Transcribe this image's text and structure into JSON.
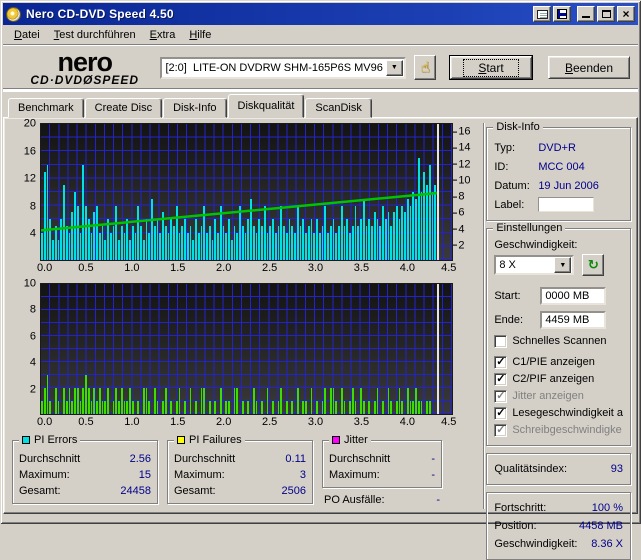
{
  "window": {
    "title": "Nero CD-DVD Speed 4.50"
  },
  "menu": {
    "items": [
      "Datei",
      "Test durchführen",
      "Extra",
      "Hilfe"
    ]
  },
  "toolbar": {
    "logo_line1": "nero",
    "logo_line2": "CD·DVDØSPEED",
    "drive": "[2:0]  LITE-ON DVDRW SHM-165P6S MV96",
    "start_label": "Start",
    "quit_label": "Beenden"
  },
  "tabs": [
    "Benchmark",
    "Create Disc",
    "Disk-Info",
    "Diskqualität",
    "ScanDisk"
  ],
  "active_tab": "Diskqualität",
  "disk_info": {
    "title": "Disk-Info",
    "rows": [
      {
        "label": "Typ:",
        "value": "DVD+R"
      },
      {
        "label": "ID:",
        "value": "MCC 004"
      },
      {
        "label": "Datum:",
        "value": "19 Jun 2006"
      }
    ],
    "label_label": "Label:"
  },
  "settings": {
    "title": "Einstellungen",
    "speed_label": "Geschwindigkeit:",
    "speed_value": "8 X",
    "start_label": "Start:",
    "start_value": "0000 MB",
    "end_label": "Ende:",
    "end_value": "4459 MB",
    "checkboxes": [
      {
        "label": "Schnelles Scannen",
        "checked": false,
        "enabled": true
      },
      {
        "label": "C1/PIE anzeigen",
        "checked": true,
        "enabled": true
      },
      {
        "label": "C2/PIF anzeigen",
        "checked": true,
        "enabled": true
      },
      {
        "label": "Jitter anzeigen",
        "checked": true,
        "enabled": false
      },
      {
        "label": "Lesegeschwindigkeit a",
        "checked": true,
        "enabled": true
      },
      {
        "label": "Schreibgeschwindigke",
        "checked": true,
        "enabled": false
      }
    ]
  },
  "quality": {
    "label": "Qualitätsindex:",
    "value": "93"
  },
  "progress": {
    "rows": [
      {
        "label": "Fortschritt:",
        "value": "100 %"
      },
      {
        "label": "Position:",
        "value": "4458 MB"
      },
      {
        "label": "Geschwindigkeit:",
        "value": "8.36 X"
      }
    ]
  },
  "stats": {
    "boxes": [
      {
        "title": "PI Errors",
        "color": "#00e0e0",
        "rows": [
          [
            "Durchschnitt",
            "2.56"
          ],
          [
            "Maximum:",
            "15"
          ],
          [
            "Gesamt:",
            "24458"
          ]
        ]
      },
      {
        "title": "PI Failures",
        "color": "#ffff00",
        "rows": [
          [
            "Durchschnitt",
            "0.11"
          ],
          [
            "Maximum:",
            "3"
          ],
          [
            "Gesamt:",
            "2506"
          ]
        ]
      },
      {
        "title": "Jitter",
        "color": "#ff00ff",
        "rows": [
          [
            "Durchschnitt",
            "-"
          ],
          [
            "Maximum:",
            "-"
          ]
        ]
      }
    ],
    "po_label": "PO Ausfälle:",
    "po_value": "-"
  },
  "colors": {
    "pi_errors_bar": "#00e2e2",
    "pi_failures_bar": "#3ddd00",
    "speed_line": "#00c400",
    "grid_line": "#2323cd",
    "value_text": "#00008a"
  },
  "chart_data": [
    {
      "type": "bar",
      "name": "PI Errors scan",
      "color": "#00e2e2",
      "xlim": [
        0,
        4.5
      ],
      "x_ticks": [
        "0.0",
        "0.5",
        "1.0",
        "1.5",
        "2.0",
        "2.5",
        "3.0",
        "3.5",
        "4.0",
        "4.5"
      ],
      "ylim": [
        0,
        20
      ],
      "y_ticks_left": [
        "20",
        "16",
        "12",
        "8",
        "4"
      ],
      "y_right_lim": [
        0,
        17
      ],
      "y_ticks_right": [
        "16",
        "14",
        "12",
        "10",
        "8",
        "6",
        "4",
        "2"
      ],
      "bar_end_x": 4.33,
      "cursor_x": 4.33,
      "values": [
        4,
        13,
        14,
        6,
        3,
        5,
        3,
        6,
        11,
        5,
        4,
        7,
        10,
        8,
        4,
        14,
        8,
        6,
        4,
        7,
        8,
        4,
        5,
        3,
        6,
        4,
        5,
        8,
        3,
        5,
        4,
        6,
        3,
        5,
        4,
        8,
        5,
        3,
        6,
        4,
        9,
        5,
        6,
        4,
        7,
        5,
        4,
        6,
        5,
        8,
        4,
        5,
        6,
        4,
        5,
        3,
        6,
        4,
        5,
        8,
        4,
        5,
        3,
        6,
        4,
        8,
        5,
        4,
        6,
        3,
        5,
        4,
        8,
        5,
        4,
        6,
        9,
        5,
        4,
        6,
        5,
        8,
        4,
        5,
        6,
        4,
        5,
        8,
        5,
        4,
        6,
        5,
        4,
        8,
        5,
        6,
        4,
        5,
        6,
        4,
        6,
        4,
        5,
        8,
        4,
        5,
        6,
        4,
        5,
        8,
        5,
        6,
        4,
        5,
        8,
        5,
        6,
        9,
        5,
        6,
        5,
        7,
        6,
        5,
        8,
        6,
        7,
        5,
        7,
        8,
        6,
        8,
        7,
        9,
        8,
        10,
        9,
        15,
        10,
        13,
        11,
        14,
        10,
        11
      ],
      "overlay_line": {
        "name": "read-speed",
        "color": "#00c400",
        "axis": "right",
        "points": [
          [
            0,
            3.7
          ],
          [
            4.33,
            8.36
          ]
        ]
      }
    },
    {
      "type": "bar",
      "name": "PI Failures scan",
      "color": "#3ddd00",
      "xlim": [
        0,
        4.5
      ],
      "x_ticks": [
        "0.0",
        "0.5",
        "1.0",
        "1.5",
        "2.0",
        "2.5",
        "3.0",
        "3.5",
        "4.0",
        "4.5"
      ],
      "ylim": [
        0,
        10
      ],
      "y_ticks_left": [
        "10",
        "8",
        "6",
        "4",
        "2"
      ],
      "bar_end_x": 4.33,
      "cursor_x": 4.33,
      "values": [
        1,
        2,
        3,
        1,
        0,
        2,
        1,
        0,
        2,
        1,
        2,
        1,
        2,
        2,
        1,
        2,
        3,
        2,
        1,
        2,
        1,
        2,
        1,
        1,
        2,
        0,
        1,
        2,
        1,
        2,
        1,
        1,
        2,
        1,
        0,
        1,
        0,
        2,
        2,
        1,
        0,
        2,
        1,
        0,
        1,
        2,
        0,
        1,
        0,
        1,
        2,
        0,
        1,
        0,
        2,
        0,
        1,
        0,
        2,
        2,
        0,
        1,
        0,
        1,
        0,
        2,
        0,
        1,
        1,
        0,
        2,
        2,
        0,
        1,
        0,
        1,
        0,
        2,
        1,
        0,
        1,
        0,
        2,
        0,
        1,
        0,
        1,
        2,
        0,
        1,
        0,
        1,
        0,
        2,
        0,
        1,
        1,
        0,
        2,
        0,
        1,
        0,
        1,
        2,
        0,
        2,
        2,
        1,
        0,
        2,
        1,
        0,
        1,
        2,
        1,
        0,
        2,
        1,
        0,
        1,
        0,
        1,
        2,
        0,
        1,
        0,
        2,
        1,
        0,
        1,
        2,
        1,
        0,
        2,
        1,
        1,
        2,
        1,
        1,
        0,
        1,
        1,
        0,
        0
      ]
    }
  ]
}
